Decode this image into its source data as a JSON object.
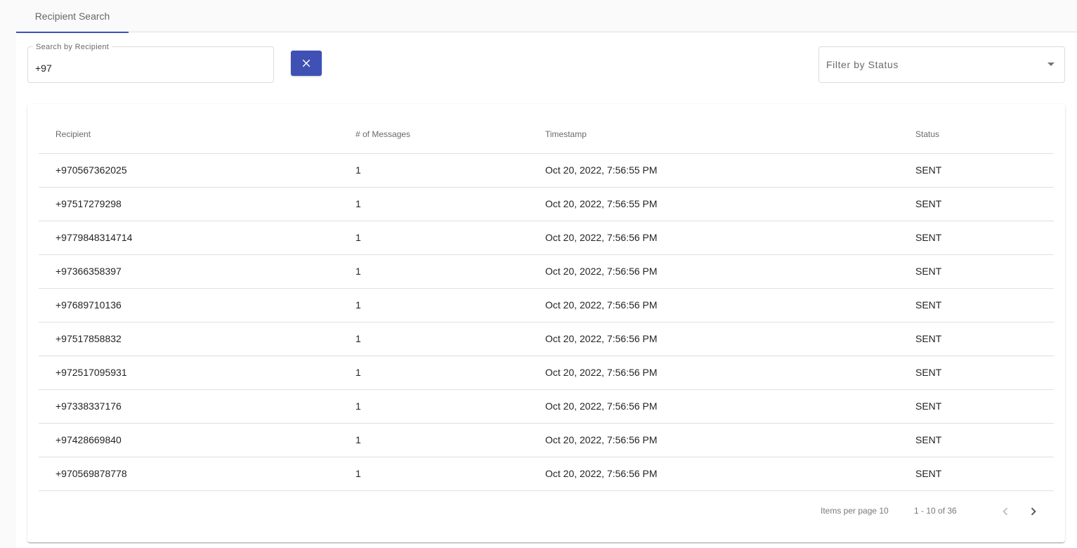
{
  "tabs": [
    {
      "label": "Recipient Search",
      "active": true
    }
  ],
  "search": {
    "label": "Search by Recipient",
    "value": "+97"
  },
  "clear_button": {
    "icon": "close-icon"
  },
  "filter": {
    "placeholder": "Filter by Status"
  },
  "colors": {
    "accent": "#3f51b5"
  },
  "table": {
    "headers": [
      "Recipient",
      "# of Messages",
      "Timestamp",
      "Status"
    ],
    "rows": [
      {
        "recipient": "+970567362025",
        "messages": "1",
        "timestamp": "Oct 20, 2022, 7:56:55 PM",
        "status": "SENT"
      },
      {
        "recipient": "+97517279298",
        "messages": "1",
        "timestamp": "Oct 20, 2022, 7:56:55 PM",
        "status": "SENT"
      },
      {
        "recipient": "+9779848314714",
        "messages": "1",
        "timestamp": "Oct 20, 2022, 7:56:56 PM",
        "status": "SENT"
      },
      {
        "recipient": "+97366358397",
        "messages": "1",
        "timestamp": "Oct 20, 2022, 7:56:56 PM",
        "status": "SENT"
      },
      {
        "recipient": "+97689710136",
        "messages": "1",
        "timestamp": "Oct 20, 2022, 7:56:56 PM",
        "status": "SENT"
      },
      {
        "recipient": "+97517858832",
        "messages": "1",
        "timestamp": "Oct 20, 2022, 7:56:56 PM",
        "status": "SENT"
      },
      {
        "recipient": "+972517095931",
        "messages": "1",
        "timestamp": "Oct 20, 2022, 7:56:56 PM",
        "status": "SENT"
      },
      {
        "recipient": "+97338337176",
        "messages": "1",
        "timestamp": "Oct 20, 2022, 7:56:56 PM",
        "status": "SENT"
      },
      {
        "recipient": "+97428669840",
        "messages": "1",
        "timestamp": "Oct 20, 2022, 7:56:56 PM",
        "status": "SENT"
      },
      {
        "recipient": "+970569878778",
        "messages": "1",
        "timestamp": "Oct 20, 2022, 7:56:56 PM",
        "status": "SENT"
      }
    ]
  },
  "paginator": {
    "items_per_page": "Items per page 10",
    "range": "1 - 10 of 36"
  }
}
